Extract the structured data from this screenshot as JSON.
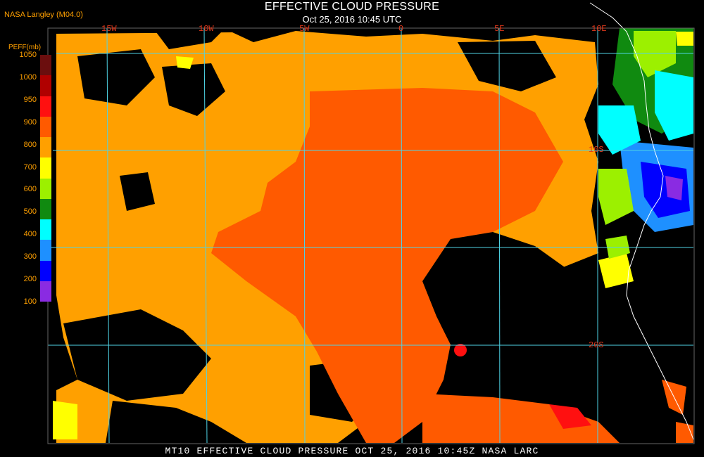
{
  "header": {
    "title": "EFFECTIVE CLOUD PRESSURE",
    "subtitle": "Oct 25, 2016 10:45 UTC",
    "credit": "NASA Langley (M04.0)"
  },
  "footer": {
    "text": "MT10  EFFECTIVE CLOUD PRESSURE  OCT 25, 2016 10:45Z  NASA LARC"
  },
  "longitude_labels": [
    "15W",
    "10W",
    "5W",
    "0",
    "5E",
    "10E"
  ],
  "latitude_labels": [
    "10S",
    "20S"
  ],
  "legend": {
    "title": "PEFF(mb)",
    "ticks": [
      "1050",
      "1000",
      "950",
      "900",
      "800",
      "700",
      "600",
      "500",
      "400",
      "300",
      "200",
      "100"
    ],
    "colors": [
      "#6b0e0e",
      "#b00000",
      "#ff1010",
      "#ff5a00",
      "#ffa000",
      "#ffff00",
      "#9cf000",
      "#108a10",
      "#00ffff",
      "#1e90ff",
      "#0000ff",
      "#8a2be2"
    ]
  },
  "colors": {
    "ocean": "#000000",
    "cloud_low_orange": "#ffa000",
    "cloud_mid_orange": "#ff5a00",
    "grid": "#4fd4e6",
    "label_red": "#e0391c"
  }
}
